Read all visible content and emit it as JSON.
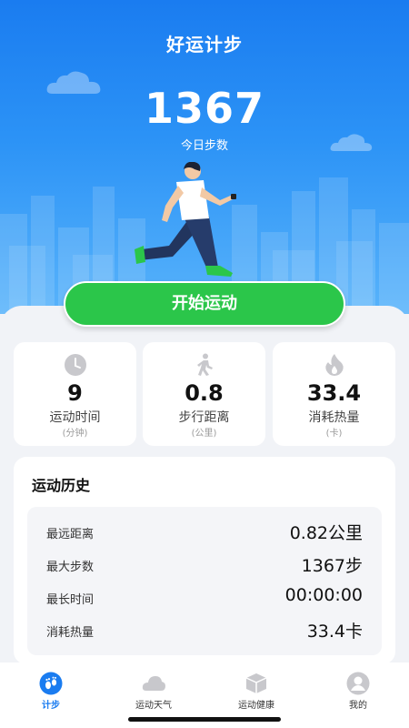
{
  "app": {
    "title": "好运计步"
  },
  "today": {
    "steps": "1367",
    "steps_label": "今日步数"
  },
  "start_button": {
    "label": "开始运动"
  },
  "stats": [
    {
      "value": "9",
      "label": "运动时间",
      "unit": "(分钟)",
      "icon": "clock-icon"
    },
    {
      "value": "0.8",
      "label": "步行距离",
      "unit": "(公里)",
      "icon": "walking-icon"
    },
    {
      "value": "33.4",
      "label": "消耗热量",
      "unit": "(卡)",
      "icon": "flame-icon"
    }
  ],
  "history": {
    "title": "运动历史",
    "rows": [
      {
        "label": "最远距离",
        "value": "0.82公里"
      },
      {
        "label": "最大步数",
        "value": "1367步"
      },
      {
        "label": "最长时间",
        "value": "00:00:00"
      },
      {
        "label": "消耗热量",
        "value": "33.4卡"
      }
    ]
  },
  "tabs": [
    {
      "label": "计步",
      "icon": "footprints-icon",
      "active": true
    },
    {
      "label": "运动天气",
      "icon": "cloud-icon",
      "active": false
    },
    {
      "label": "运动健康",
      "icon": "cube-icon",
      "active": false
    },
    {
      "label": "我的",
      "icon": "profile-icon",
      "active": false
    }
  ],
  "colors": {
    "accent": "#1a7cf0",
    "start_button": "#2bc64a",
    "icon_gray": "#c8c8cc"
  }
}
